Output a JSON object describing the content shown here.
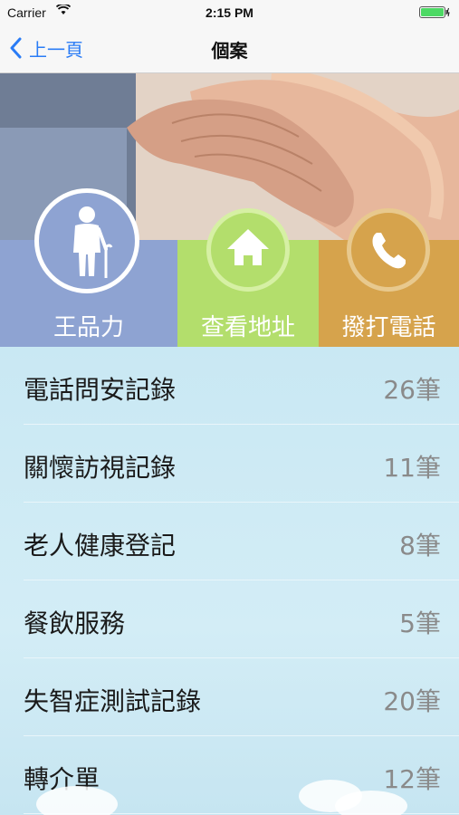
{
  "status_bar": {
    "carrier": "Carrier",
    "time": "2:15 PM"
  },
  "nav": {
    "back_label": "上一頁",
    "title": "個案"
  },
  "actions": {
    "person_name": "王品力",
    "address_label": "查看地址",
    "call_label": "撥打電話"
  },
  "records": [
    {
      "label": "電話問安記錄",
      "count": "26筆"
    },
    {
      "label": "關懷訪視記錄",
      "count": "11筆"
    },
    {
      "label": "老人健康登記",
      "count": "8筆"
    },
    {
      "label": "餐飲服務",
      "count": "5筆"
    },
    {
      "label": "失智症測試記錄",
      "count": "20筆"
    },
    {
      "label": "轉介單",
      "count": "12筆"
    }
  ],
  "colors": {
    "accent": "#2a7cf6",
    "person_tile": "#8ea3d2",
    "address_tile": "#b3de6c",
    "call_tile": "#d6a34c",
    "list_background": "#c9e8f3"
  },
  "icons": [
    "wifi-icon",
    "battery-icon",
    "back-chevron-icon",
    "elderly-person-icon",
    "home-icon",
    "phone-icon"
  ]
}
